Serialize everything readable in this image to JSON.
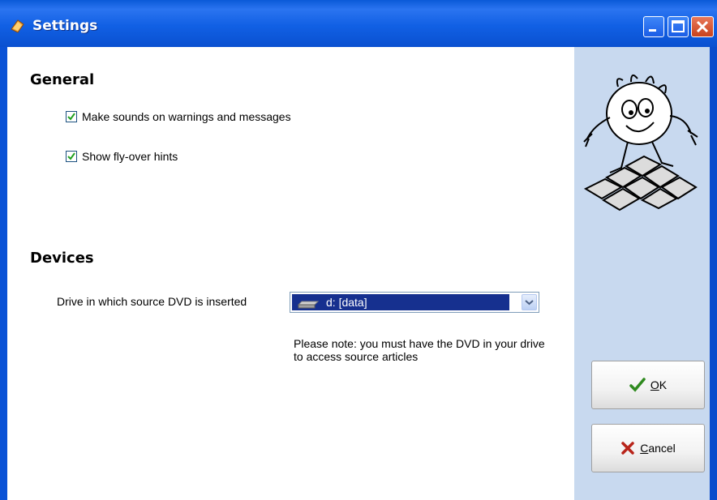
{
  "window": {
    "title": "Settings",
    "colors": {
      "titlebar": "#1160e4",
      "side_panel": "#c8d9ef",
      "selection": "#16308f"
    }
  },
  "general": {
    "heading": "General",
    "options": [
      {
        "label": "Make sounds on warnings and messages",
        "checked": true
      },
      {
        "label": "Show fly-over hints",
        "checked": true
      }
    ]
  },
  "devices": {
    "heading": "Devices",
    "drive_label": "Drive in which source DVD is inserted",
    "drive_selected": "d: [data]",
    "note": "Please note: you must have the DVD in your drive to access source articles"
  },
  "buttons": {
    "ok_mnemonic": "O",
    "ok_rest": "K",
    "cancel_mnemonic": "C",
    "cancel_rest": "ancel"
  },
  "icons": {
    "title": "app-icon",
    "ok": "checkmark-icon",
    "cancel": "x-icon",
    "drive": "drive-icon",
    "dropdown": "chevron-down-icon",
    "mascot": "mascot-illustration"
  }
}
